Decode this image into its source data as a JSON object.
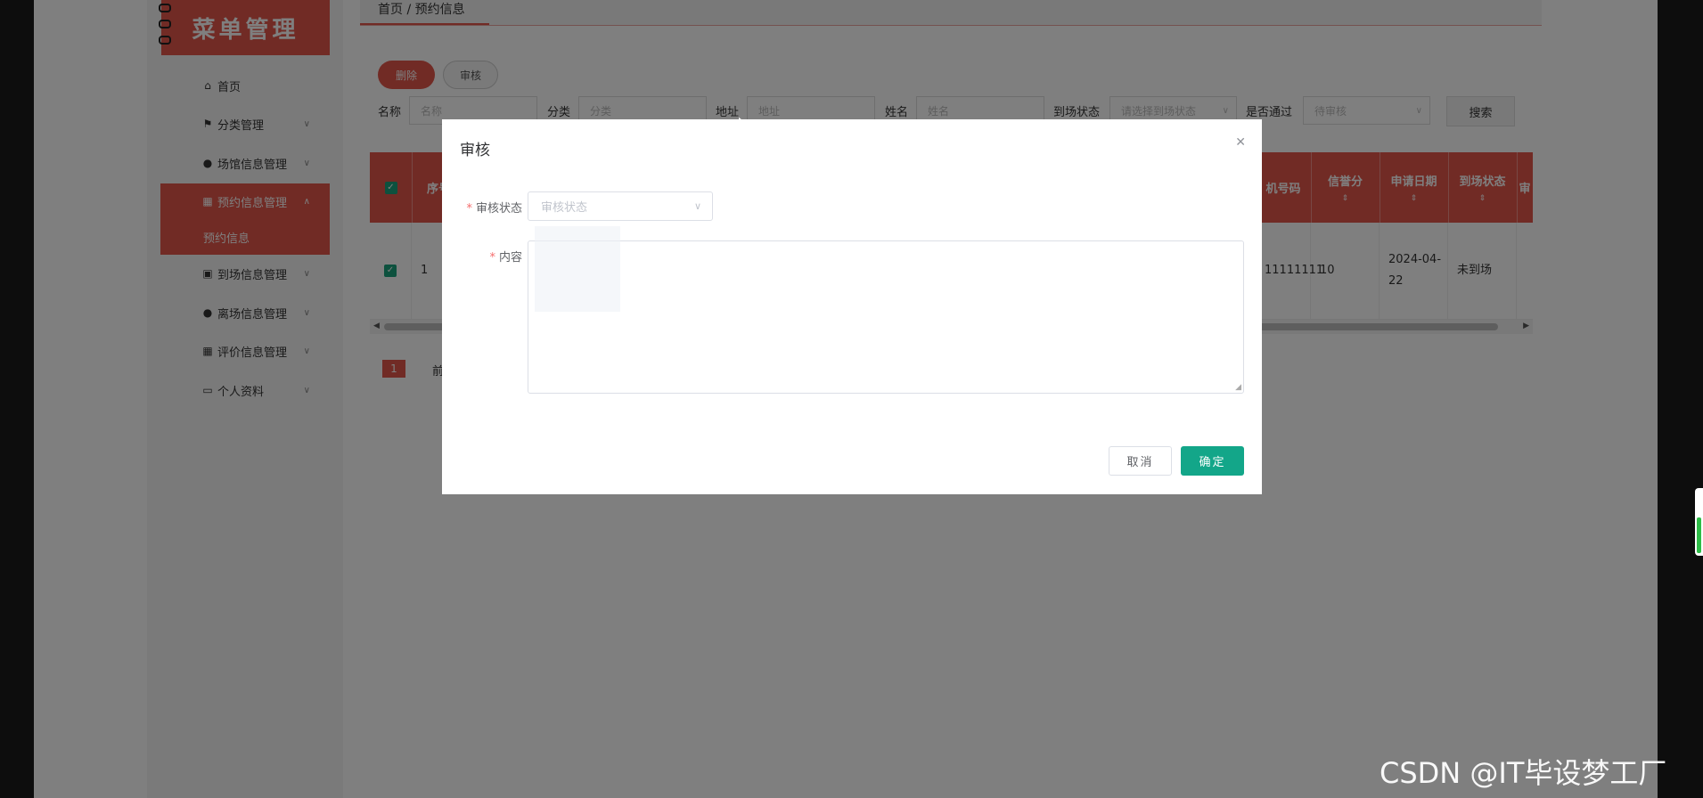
{
  "logo": {
    "text": "菜单管理"
  },
  "sidebar": {
    "items": [
      {
        "label": "首页",
        "icon": "home-icon"
      },
      {
        "label": "分类管理",
        "icon": "flag-icon"
      },
      {
        "label": "场馆信息管理",
        "icon": "user-icon"
      },
      {
        "label": "预约信息管理",
        "icon": "grid-icon"
      },
      {
        "label": "到场信息管理",
        "icon": "clipboard-icon"
      },
      {
        "label": "离场信息管理",
        "icon": "user-icon"
      },
      {
        "label": "评价信息管理",
        "icon": "grid-icon"
      },
      {
        "label": "个人资料",
        "icon": "calendar-icon"
      }
    ],
    "submenu": {
      "label": "预约信息"
    }
  },
  "breadcrumb": {
    "text": "首页 / 预约信息"
  },
  "toolbar": {
    "delete_label": "删除",
    "audit_label": "审核"
  },
  "filters": {
    "name_label": "名称",
    "name_placeholder": "名称",
    "category_label": "分类",
    "category_placeholder": "分类",
    "address_label": "地址",
    "address_placeholder": "地址",
    "person_label": "姓名",
    "person_placeholder": "姓名",
    "arrival_label": "到场状态",
    "arrival_placeholder": "请选择到场状态",
    "pass_label": "是否通过",
    "pass_value": "待审核",
    "search_label": "搜索"
  },
  "table": {
    "headers": [
      "序号",
      "机号码",
      "信誉分",
      "申请日期",
      "到场状态",
      "审"
    ],
    "row": {
      "index": "1",
      "phone": "11111111",
      "credit": "10",
      "date": "2024-04-22",
      "arrival": "未到场"
    }
  },
  "pager": {
    "current": "1",
    "prev": "前"
  },
  "modal": {
    "title": "审核",
    "status_label": "审核状态",
    "status_placeholder": "审核状态",
    "content_label": "内容",
    "cancel_label": "取消",
    "ok_label": "确定"
  },
  "watermark": {
    "text": "CSDN @IT毕设梦工厂"
  },
  "colors": {
    "accent": "#e2564a",
    "confirm": "#13a689"
  }
}
